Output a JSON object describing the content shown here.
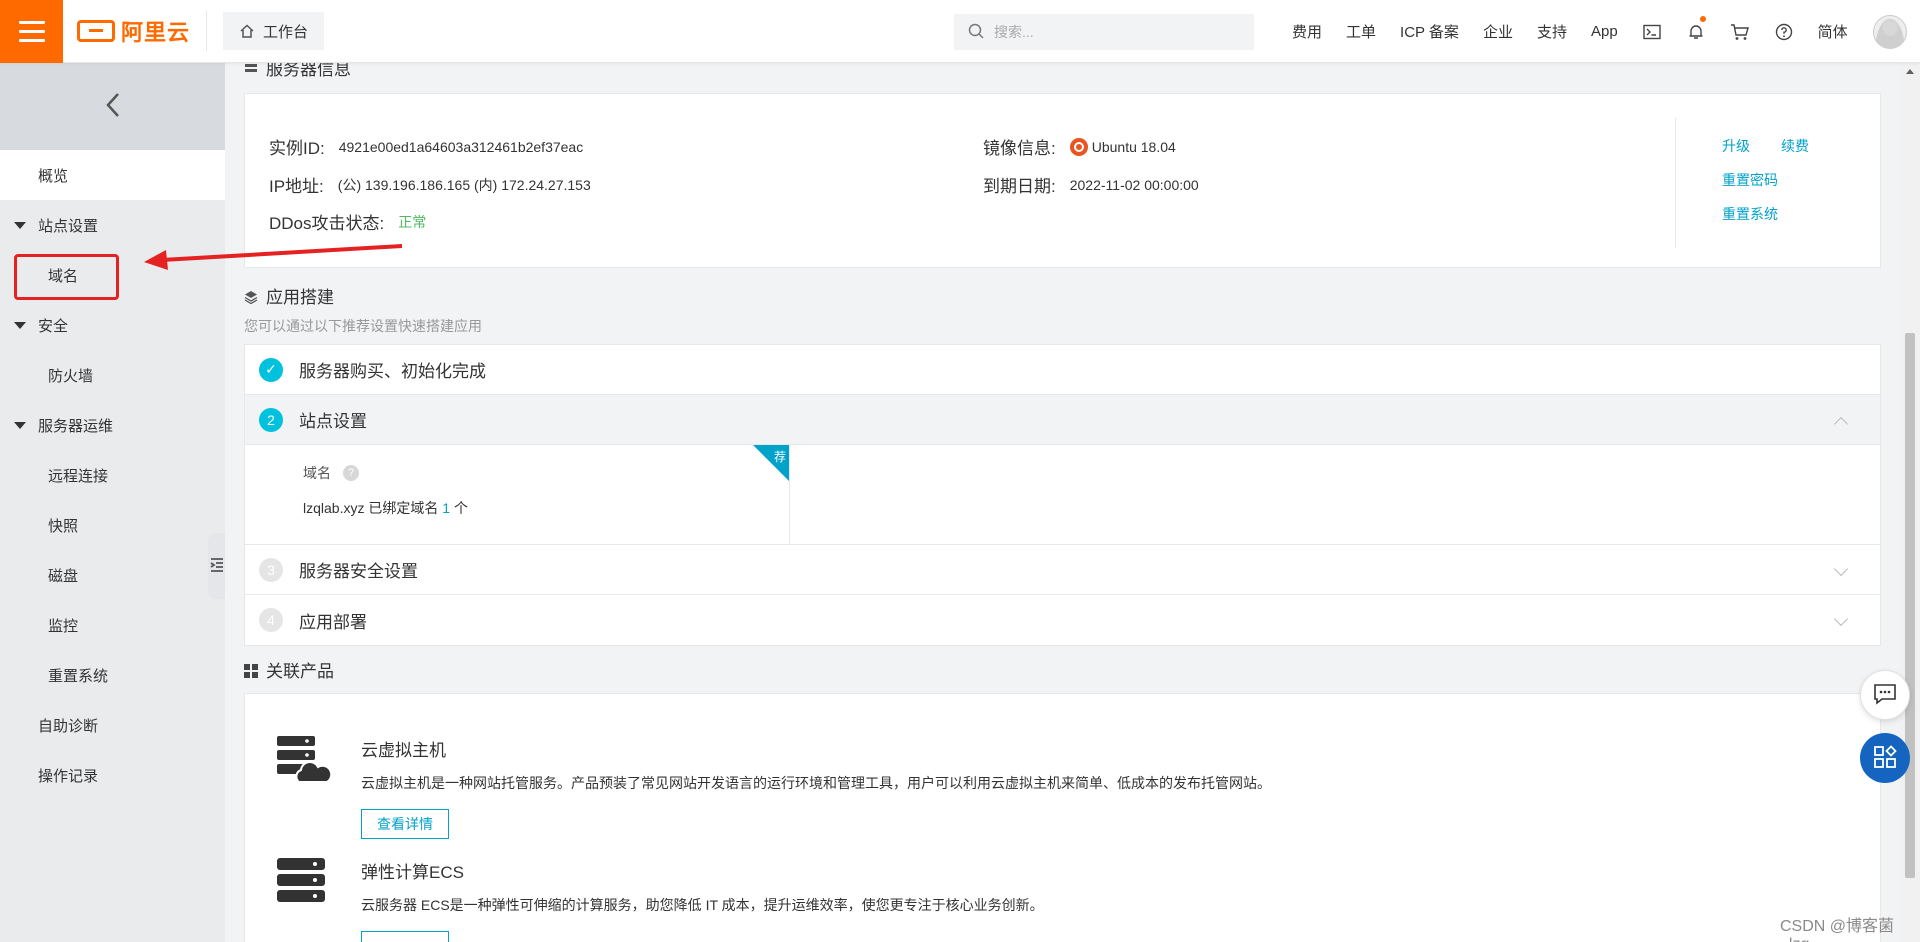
{
  "header": {
    "logo_text": "阿里云",
    "workbench_label": "工作台",
    "search_placeholder": "搜索...",
    "nav_links": [
      "费用",
      "工单",
      "ICP 备案",
      "企业",
      "支持",
      "App"
    ],
    "language": "简体"
  },
  "sidebar": {
    "overview": "概览",
    "site_settings": "站点设置",
    "domain": "域名",
    "security": "安全",
    "firewall": "防火墙",
    "server_ops": "服务器运维",
    "remote": "远程连接",
    "snapshot": "快照",
    "disk": "磁盘",
    "monitor": "监控",
    "reset_system": "重置系统",
    "self_diagnose": "自助诊断",
    "op_log": "操作记录"
  },
  "server_info": {
    "title": "服务器信息",
    "instance_id_label": "实例ID:",
    "instance_id": "4921e00ed1a64603a312461b2ef37eac",
    "ip_label": "IP地址:",
    "ip_value": "(公) 139.196.186.165 (内) 172.24.27.153",
    "ddos_label": "DDos攻击状态:",
    "ddos_value": "正常",
    "image_label": "镜像信息:",
    "image_value": "Ubuntu 18.04",
    "expire_label": "到期日期:",
    "expire_value": "2022-11-02 00:00:00",
    "actions": {
      "upgrade": "升级",
      "renew": "续费",
      "reset_password": "重置密码",
      "reset_system": "重置系统"
    }
  },
  "app_build": {
    "title": "应用搭建",
    "hint": "您可以通过以下推荐设置快速搭建应用",
    "steps": [
      {
        "num": "✓",
        "label": "服务器购买、初始化完成"
      },
      {
        "num": "2",
        "label": "站点设置"
      },
      {
        "num": "3",
        "label": "服务器安全设置"
      },
      {
        "num": "4",
        "label": "应用部署"
      }
    ],
    "domain_label": "域名",
    "help": "?",
    "ribbon": "荐",
    "bound_prefix": "lzqlab.xyz 已绑定域名",
    "bound_count": "1",
    "bound_suffix": "个"
  },
  "related": {
    "title": "关联产品",
    "products": [
      {
        "name": "云虚拟主机",
        "desc": "云虚拟主机是一种网站托管服务。产品预装了常见网站开发语言的运行环境和管理工具，用户可以利用云虚拟主机来简单、低成本的发布托管网站。",
        "button": "查看详情"
      },
      {
        "name": "弹性计算ECS",
        "desc": "云服务器 ECS是一种弹性可伸缩的计算服务，助您降低 IT 成本，提升运维效率，使您更专注于核心业务创新。",
        "button": ""
      }
    ]
  },
  "watermark": "CSDN @博客菌_lzq"
}
